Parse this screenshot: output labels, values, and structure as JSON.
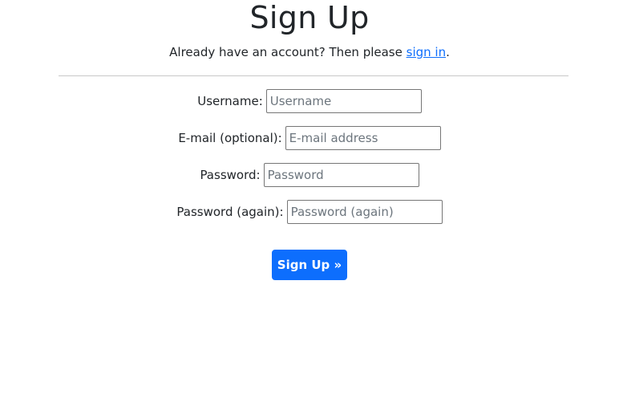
{
  "page": {
    "title": "Sign Up"
  },
  "intro": {
    "text_before": "Already have an account? Then please ",
    "link_label": "sign in",
    "text_after": "."
  },
  "form": {
    "username": {
      "label": "Username:",
      "placeholder": "Username",
      "value": ""
    },
    "email": {
      "label": "E-mail (optional):",
      "placeholder": "E-mail address",
      "value": ""
    },
    "password": {
      "label": "Password:",
      "placeholder": "Password",
      "value": ""
    },
    "password_again": {
      "label": "Password (again):",
      "placeholder": "Password (again)",
      "value": ""
    },
    "submit_label": "Sign Up »"
  },
  "colors": {
    "accent": "#0d6efd",
    "text": "#212529",
    "divider": "#c8c8c8"
  }
}
